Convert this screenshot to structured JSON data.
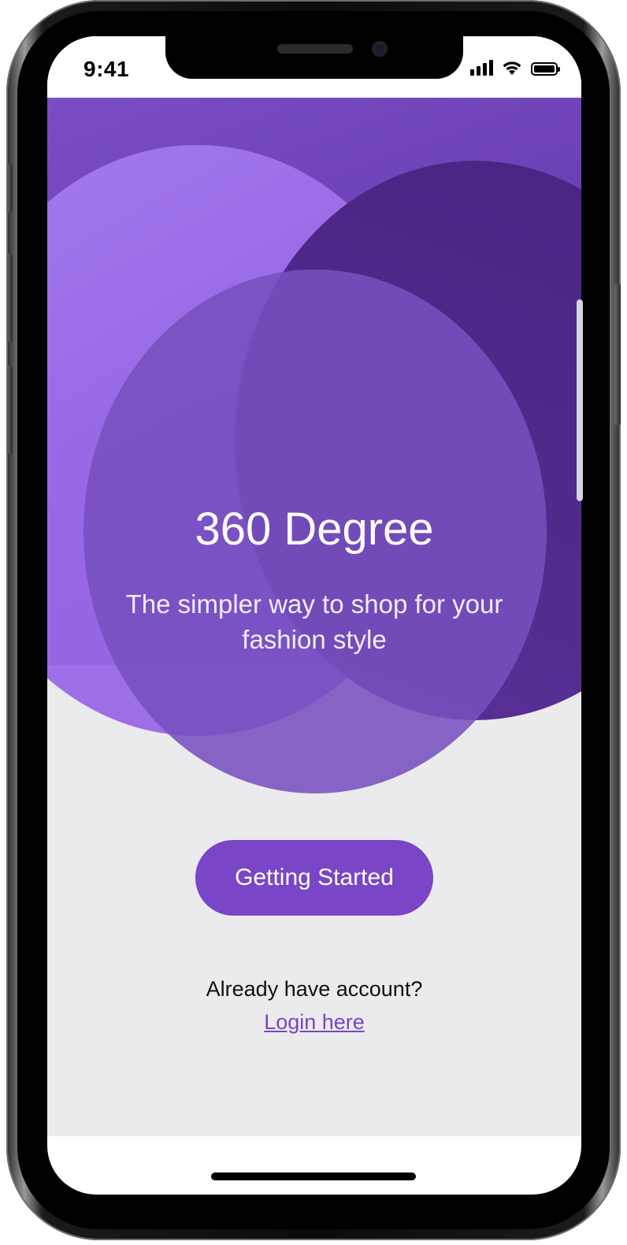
{
  "status_bar": {
    "time": "9:41",
    "icons": [
      "signal-icon",
      "wifi-icon",
      "battery-icon"
    ]
  },
  "hero": {
    "title": "360 Degree",
    "subtitle": "The simpler way to shop for your fashion style"
  },
  "actions": {
    "primary_button_label": "Getting Started",
    "account_prompt": "Already have account?",
    "login_link_label": "Login here"
  },
  "colors": {
    "accent": "#7a45c6",
    "background": "#ebebed",
    "hero_dark": "#512a8c",
    "hero_light": "#a77ef0"
  }
}
